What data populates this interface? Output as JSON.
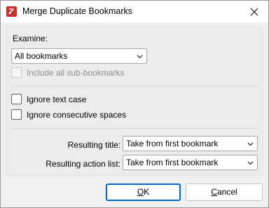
{
  "window": {
    "title": "Merge Duplicate Bookmarks"
  },
  "examine": {
    "label": "Examine:",
    "selected": "All bookmarks",
    "include_sub_label": "Include all sub-bookmarks"
  },
  "options": {
    "ignore_case_label": "Ignore text case",
    "ignore_spaces_label": "Ignore consecutive spaces"
  },
  "resulting_title": {
    "label": "Resulting title:",
    "selected": "Take from first bookmark"
  },
  "resulting_action": {
    "label": "Resulting action list:",
    "selected": "Take from first bookmark"
  },
  "buttons": {
    "ok": "OK",
    "cancel": "Cancel"
  },
  "icons": {
    "app": "pdf-app-icon",
    "close": "close-icon",
    "dropdown": "chevron-down-icon"
  },
  "colors": {
    "accent": "#0067c0",
    "app_icon": "#c8322c"
  }
}
